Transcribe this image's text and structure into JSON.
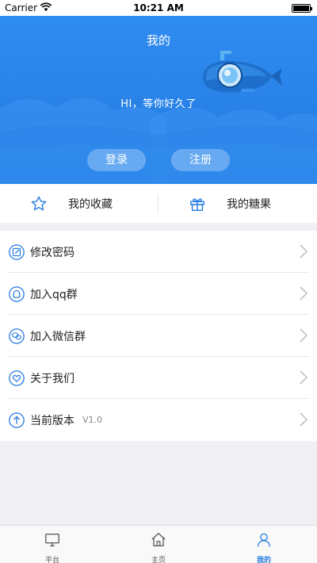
{
  "status_bar": {
    "carrier": "Carrier",
    "time": "10:21 AM"
  },
  "header": {
    "title": "我的",
    "greeting": "HI，等你好久了",
    "login_label": "登录",
    "register_label": "注册",
    "bg_color": "#2379e0"
  },
  "quick_links": [
    {
      "label": "我的收藏",
      "icon": "star-icon"
    },
    {
      "label": "我的糖果",
      "icon": "gift-icon"
    }
  ],
  "menu": [
    {
      "label": "修改密码",
      "icon": "edit-icon"
    },
    {
      "label": "加入qq群",
      "icon": "qq-icon"
    },
    {
      "label": "加入微信群",
      "icon": "wechat-icon"
    },
    {
      "label": "关于我们",
      "icon": "heart-icon"
    },
    {
      "label": "当前版本",
      "icon": "upload-arrow-icon",
      "value": "V1.0"
    }
  ],
  "tabbar": [
    {
      "label": "平台",
      "icon": "monitor-icon",
      "active": false
    },
    {
      "label": "主页",
      "icon": "home-icon",
      "active": false
    },
    {
      "label": "我的",
      "icon": "user-icon",
      "active": true
    }
  ],
  "accent_color": "#2379e0"
}
